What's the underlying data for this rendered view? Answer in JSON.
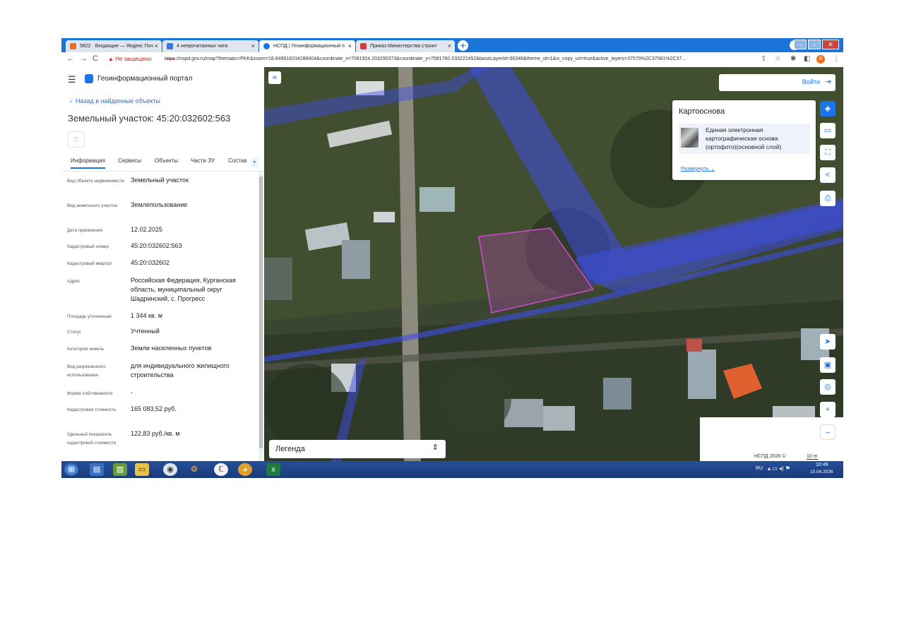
{
  "browser": {
    "tabs": [
      {
        "title": "5822 · Входящие — Яндекс Поч",
        "color": "#f46b1c"
      },
      {
        "title": "4 непрочитанных чата",
        "color": "#3a78d8"
      },
      {
        "title": "НСПД | Геоинформационный п",
        "color": "#1a73e8"
      },
      {
        "title": "Приказ Министерства строит",
        "color": "#d23e3e"
      }
    ],
    "new_tab": "+",
    "avatar_letter": "И",
    "insecure_label": "Не защищено",
    "url_scheme": "https",
    "url_rest": "://nspd.gov.ru/map?thematic=PKK&zoom=18.849918334288404&coordinate_x=7081924.203290373&coordinate_y=7581760.033222452&baseLayerId=36346&theme_id=1&is_copy_url=true&active_layers=37579%2C37581%2C37..."
  },
  "panel": {
    "portal_title": "Геоинформационный портал",
    "back_link": "Назад в найденные объекты",
    "parcel_title": "Земельный участок: 45:20:032602:563",
    "tabs": [
      "Информация",
      "Сервисы",
      "Объекты",
      "Части ЗУ",
      "Состав"
    ],
    "properties": [
      {
        "label": "Вид объекта недвижимости",
        "value": "Земельный участок"
      },
      {
        "label": "Вид земельного участка",
        "value": "Землепользование"
      },
      {
        "label": "Дата присвоения",
        "value": "12.02.2025"
      },
      {
        "label": "Кадастровый номер",
        "value": "45:20:032602:563"
      },
      {
        "label": "Кадастровый квартал",
        "value": "45:20:032602"
      },
      {
        "label": "Адрес",
        "value": "Российская Федерация, Курганская область, муниципальный округ Шадринский, с. Прогресс"
      },
      {
        "label": "Площадь уточненная",
        "value": "1 344 кв. м"
      },
      {
        "label": "Статус",
        "value": "Учтенный"
      },
      {
        "label": "Категория земель",
        "value": "Земли населенных пунктов"
      },
      {
        "label": "Вид разрешенного использования",
        "value": "для индивидуального жилищного строительства"
      },
      {
        "label": "Форма собственности",
        "value": "-"
      },
      {
        "label": "Кадастровая стоимость",
        "value": "165 083,52 руб."
      },
      {
        "label": "Удельный показатель кадастровой стоимости",
        "value": "122,83 руб./кв. м"
      }
    ]
  },
  "map": {
    "login_label": "Войти",
    "basemap_title": "Картооснова",
    "basemap_item": "Единая электронная картографическая основа (ортофото)(основной слой)",
    "basemap_expand": "Развернуть",
    "legend_label": "Легенда",
    "attribution": "НСПД 2026 ©",
    "scale_label": "10 m",
    "collapse_icon": "«",
    "zoom_in": "+",
    "zoom_out": "−"
  },
  "taskbar": {
    "language": "RU",
    "time": "10:49",
    "date": "10.04.2026"
  }
}
